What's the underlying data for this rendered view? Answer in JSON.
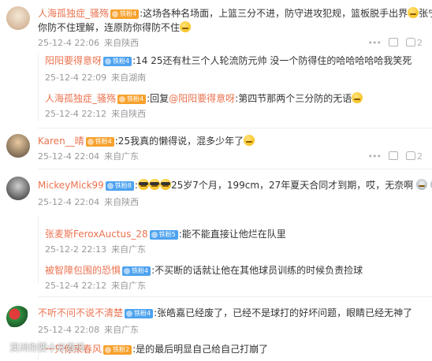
{
  "comments": [
    {
      "user": "人海孤独症_骚殇",
      "badge": "铁粉4",
      "text1": ":这场各种名场面，上篮三分不进，防守进攻犯规，篮板脱手出界",
      "text1b": "张宁",
      "text2": "你防不住理解，连原防你得防不住",
      "time": "25-12-4 22:06",
      "location": "来自陕西",
      "replies": [
        {
          "user": "阳阳要得意呀",
          "badge": "铁粉4",
          "text": ":14 25还有杜三个人轮流防元帅 没一个防得住的哈哈哈哈哈我笑死",
          "time": "25-12-4 22:09",
          "location": "来自湖南"
        },
        {
          "user": "人海孤独症_骚殇",
          "badge": "铁粉4",
          "prefix": ":回复",
          "mention": "@阳阳要得意呀",
          "text": ":第四节那两个三分防的无语",
          "time": "25-12-4 22:12",
          "location": "来自陕西"
        }
      ]
    },
    {
      "user": "Karen__晴",
      "badge": "铁粉4",
      "text1": ":25我真的懒得说，混多少年了",
      "time": "25-12-4 22:04",
      "location": "来自广东"
    },
    {
      "user": "MickeyMick99",
      "badge": "铁粉8",
      "text1": "25岁7个月，199cm，27年夏天合同才到期，哎，无奈啊",
      "time": "25-12-4 22:04",
      "location": "来自陕西",
      "replies": [
        {
          "user": "张麦斯FeroxAuctus_28",
          "badge": "铁粉5",
          "text": ":能不能直接让他烂在队里",
          "time": "25-12-2 22:13",
          "location": "来自广东"
        },
        {
          "user": "被智障包围的恐惧",
          "badge": "铁粉4",
          "text": ":不买断的话就让他在其他球员训练的时候负责捡球",
          "time": "25-12-4 22:12",
          "location": "来自广东"
        }
      ]
    },
    {
      "user": "不听不问不说不清楚",
      "badge": "铁粉4",
      "text1": ":张皓嘉已经废了，已经不是球打的好坏问题，眼睛已经无神了",
      "time": "25-12-4 22:08",
      "location": "来自广东",
      "replies": [
        {
          "user": "一只你来春风",
          "badge": "铁粉2",
          "text": ":是的最后明显自己给自己打崩了"
        }
      ]
    }
  ],
  "watermark": "澳洲你要小米春风",
  "colors": {
    "username": "#eb7350",
    "meta": "#999999",
    "badge_orange": "#f7a12c",
    "badge_blue": "#4ea3ef"
  }
}
